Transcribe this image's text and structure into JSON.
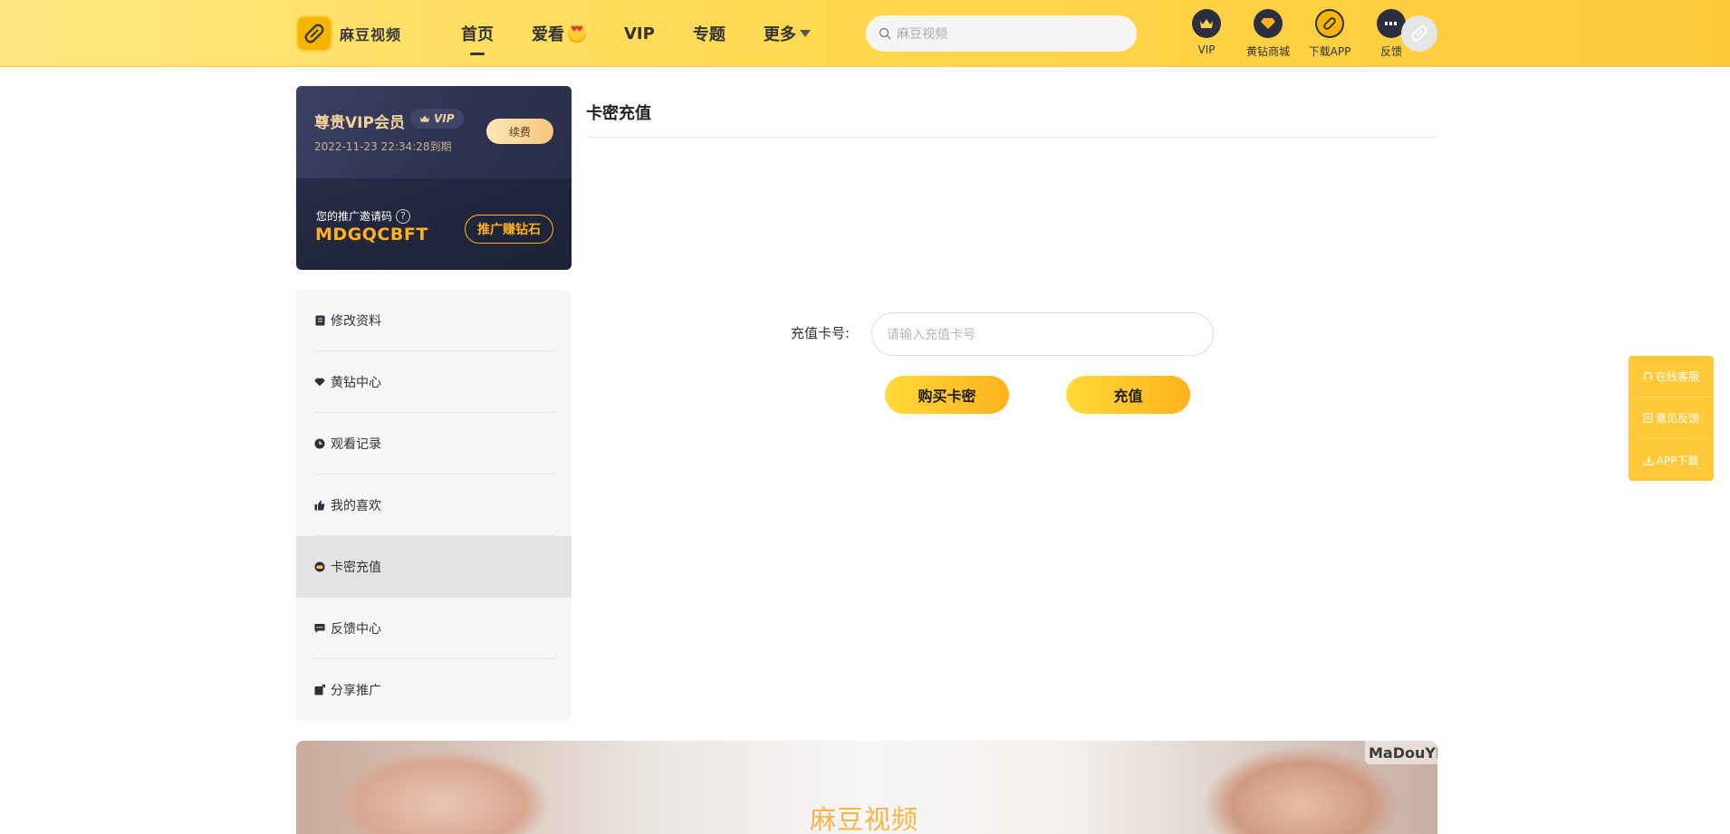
{
  "header": {
    "logo_text": "麻豆视频",
    "nav": [
      {
        "label": "首页",
        "active": true
      },
      {
        "label": "爱看",
        "active": false
      },
      {
        "label": "VIP",
        "active": false
      },
      {
        "label": "专题",
        "active": false
      },
      {
        "label": "更多",
        "active": false
      }
    ],
    "search_placeholder": "麻豆视频",
    "icons": [
      {
        "label": "VIP",
        "icon": "crown-icon"
      },
      {
        "label": "黄钻商城",
        "icon": "diamond-icon"
      },
      {
        "label": "下载APP",
        "icon": "app-logo-icon"
      },
      {
        "label": "反馈",
        "icon": "chat-bubble-icon"
      }
    ]
  },
  "vip_card": {
    "title": "尊贵VIP会员",
    "badge": "VIP",
    "expire": "2022-11-23 22:34:28到期",
    "renew_label": "续费",
    "invite_label": "您的推广邀请码",
    "invite_code": "MDGQCBFT",
    "promo_label": "推广赚钻石"
  },
  "menu": [
    {
      "label": "修改资料",
      "icon": "edit-icon",
      "active": false
    },
    {
      "label": "黄钻中心",
      "icon": "diamond-icon",
      "active": false
    },
    {
      "label": "观看记录",
      "icon": "clock-icon",
      "active": false
    },
    {
      "label": "我的喜欢",
      "icon": "thumb-up-icon",
      "active": false
    },
    {
      "label": "卡密充值",
      "icon": "gamepad-icon",
      "active": true
    },
    {
      "label": "反馈中心",
      "icon": "comment-icon",
      "active": false
    },
    {
      "label": "分享推广",
      "icon": "share-icon",
      "active": false
    }
  ],
  "main": {
    "title": "卡密充值",
    "card_label": "充值卡号:",
    "card_placeholder": "请输入充值卡号",
    "buy_label": "购买卡密",
    "charge_label": "充值"
  },
  "float_panel": [
    {
      "label": "在线客服",
      "icon": "headset-icon"
    },
    {
      "label": "意见反馈",
      "icon": "note-icon"
    },
    {
      "label": "APP下载",
      "icon": "download-icon"
    }
  ],
  "banner": {
    "title": "麻豆视频",
    "watermark": "MaDouYM"
  },
  "colors": {
    "accent": "#ffc93a",
    "brand_dark": "#2b2f3f",
    "gold": "#ffb21e"
  }
}
